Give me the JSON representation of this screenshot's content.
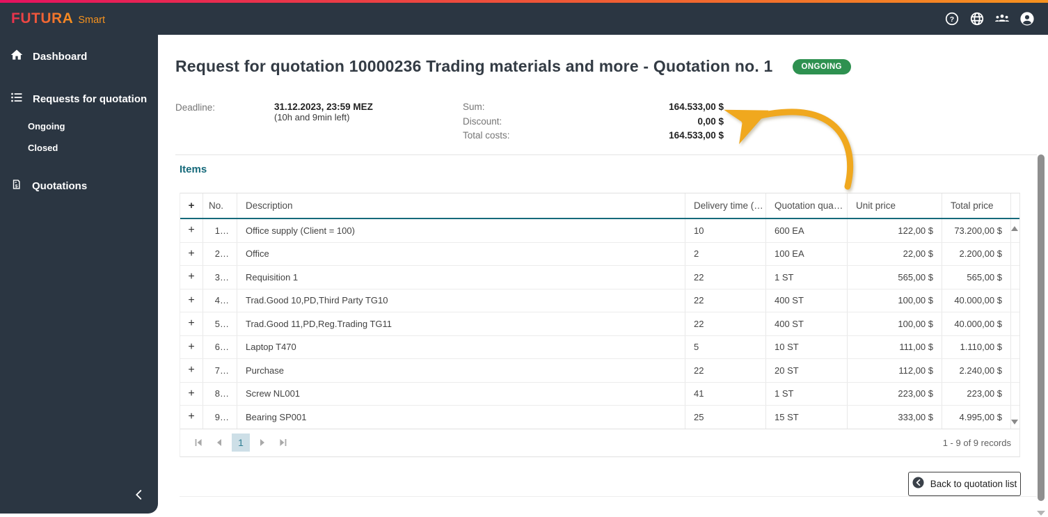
{
  "header": {
    "brand": {
      "name": "FUTURA",
      "suffix": "Smart"
    },
    "icons": [
      "help-icon",
      "language-globe-icon",
      "users-icon",
      "account-icon"
    ]
  },
  "sidebar": {
    "items": [
      {
        "icon": "home-icon",
        "label": "Dashboard"
      },
      {
        "icon": "list-icon",
        "label": "Requests for quotation",
        "children": [
          "Ongoing",
          "Closed"
        ]
      },
      {
        "icon": "quotation-receipt-icon",
        "label": "Quotations"
      }
    ],
    "collapse_icon": "chevron-left-icon"
  },
  "main": {
    "title": "Request for quotation 10000236 Trading materials and more - Quotation no. 1",
    "status_badge": "ONGOING",
    "deadline": {
      "label": "Deadline:",
      "value": "31.12.2023, 23:59 MEZ",
      "remaining": "(10h and 9min left)"
    },
    "summary": [
      {
        "label": "Sum:",
        "value": "164.533,00 $"
      },
      {
        "label": "Discount:",
        "value": "0,00 $"
      },
      {
        "label": "Total costs:",
        "value": "164.533,00 $"
      }
    ],
    "items_section": {
      "heading": "Items",
      "table": {
        "columns": [
          "+",
          "No.",
          "Description",
          "Delivery time (…",
          "Quotation qua…",
          "Unit price",
          "Total price"
        ],
        "rows": [
          {
            "no": "1…",
            "description": "Office supply (Client = 100)",
            "delivery_time": "10",
            "quantity": "600 EA",
            "unit_price": "122,00 $",
            "total_price": "73.200,00 $"
          },
          {
            "no": "2…",
            "description": "Office",
            "delivery_time": "2",
            "quantity": "100 EA",
            "unit_price": "22,00 $",
            "total_price": "2.200,00 $"
          },
          {
            "no": "3…",
            "description": "Requisition 1",
            "delivery_time": "22",
            "quantity": "1 ST",
            "unit_price": "565,00 $",
            "total_price": "565,00 $"
          },
          {
            "no": "4…",
            "description": "Trad.Good 10,PD,Third Party TG10",
            "delivery_time": "22",
            "quantity": "400 ST",
            "unit_price": "100,00 $",
            "total_price": "40.000,00 $"
          },
          {
            "no": "5…",
            "description": "Trad.Good 11,PD,Reg.Trading TG11",
            "delivery_time": "22",
            "quantity": "400 ST",
            "unit_price": "100,00 $",
            "total_price": "40.000,00 $"
          },
          {
            "no": "6…",
            "description": "Laptop T470",
            "delivery_time": "5",
            "quantity": "10 ST",
            "unit_price": "111,00 $",
            "total_price": "1.110,00 $"
          },
          {
            "no": "7…",
            "description": "Purchase",
            "delivery_time": "22",
            "quantity": "20 ST",
            "unit_price": "112,00 $",
            "total_price": "2.240,00 $"
          },
          {
            "no": "8…",
            "description": "Screw NL001",
            "delivery_time": "41",
            "quantity": "1 ST",
            "unit_price": "223,00 $",
            "total_price": "223,00 $"
          },
          {
            "no": "9…",
            "description": "Bearing SP001",
            "delivery_time": "25",
            "quantity": "15 ST",
            "unit_price": "333,00 $",
            "total_price": "4.995,00 $"
          }
        ]
      },
      "pagination": {
        "current_page": "1",
        "records": "1 - 9 of 9 records"
      }
    },
    "back_button": "Back to quotation list"
  },
  "colors": {
    "topbar_dark": "#2b3642",
    "stripe_gradient_from": "#e5115f",
    "stripe_gradient_to": "#f6921e",
    "accent_teal": "#15697a",
    "badge_green": "#2e9150",
    "annotation_arrow_yellow": "#f0a81e"
  }
}
